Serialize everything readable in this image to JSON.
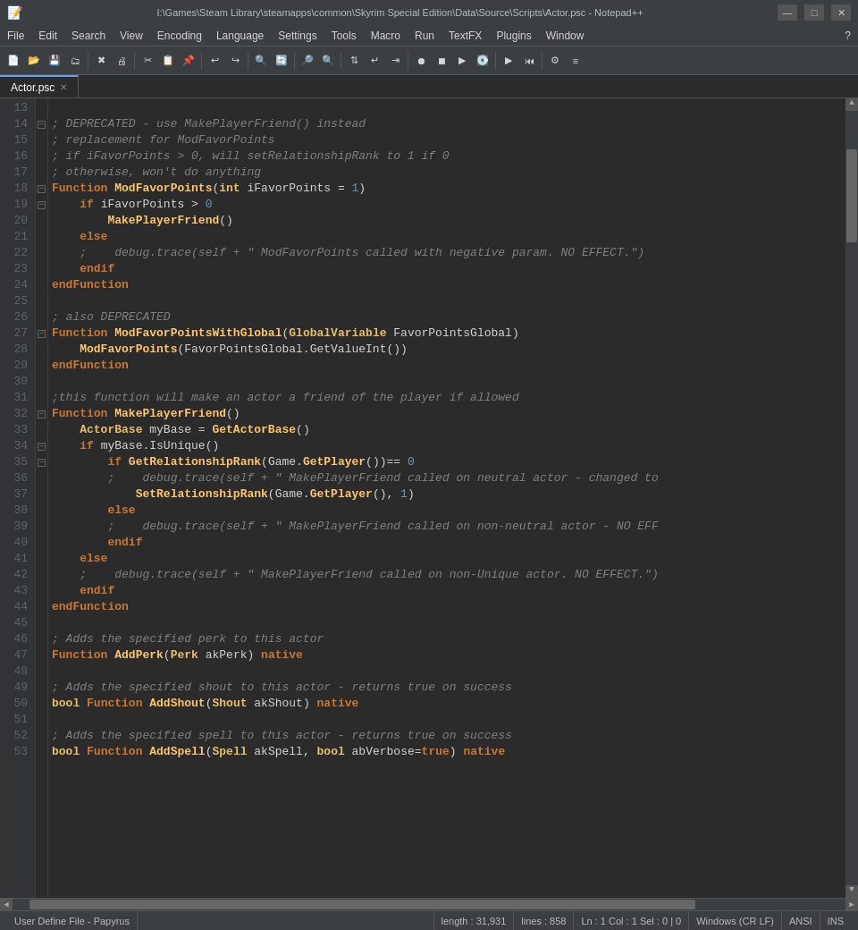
{
  "window": {
    "title": "I:\\Games\\Steam Library\\steamapps\\common\\Skyrim Special Edition\\Data\\Source\\Scripts\\Actor.psc - Notepad++",
    "controls": {
      "minimize": "—",
      "maximize": "□",
      "close": "✕"
    }
  },
  "menu": {
    "items": [
      "File",
      "Edit",
      "Search",
      "View",
      "Encoding",
      "Language",
      "Settings",
      "Tools",
      "Macro",
      "Run",
      "TextFX",
      "Plugins",
      "Window",
      "?"
    ]
  },
  "tab": {
    "label": "Actor.psc"
  },
  "status_bar": {
    "file_type": "User Define File - Papyrus",
    "length": "length : 31,931",
    "lines": "lines : 858",
    "cursor": "Ln : 1   Col : 1   Sel : 0 | 0",
    "line_ending": "Windows (CR LF)",
    "encoding": "ANSI",
    "insert": "INS"
  },
  "lines": [
    {
      "num": "13",
      "fold": "",
      "content": ""
    },
    {
      "num": "14",
      "fold": "⊟",
      "content": "<comment>; DEPRECATED - use MakePlayerFriend() instead</comment>"
    },
    {
      "num": "15",
      "fold": "",
      "content": "<comment>; replacement for ModFavorPoints</comment>"
    },
    {
      "num": "16",
      "fold": "",
      "content": "<comment>; if iFavorPoints &gt; 0, will setRelationshipRank to 1 if 0</comment>"
    },
    {
      "num": "17",
      "fold": "",
      "content": "<comment>; otherwise, won't do anything</comment>"
    },
    {
      "num": "18",
      "fold": "⊟",
      "content": "<kw>Function</kw> <fn>ModFavorPoints</fn>(<type>int</type> iFavorPoints = <num>1</num>)"
    },
    {
      "num": "19",
      "fold": "⊟",
      "content": "    <kw>if</kw> iFavorPoints &gt; <num>0</num>"
    },
    {
      "num": "20",
      "fold": "",
      "content": "        <fn>MakePlayerFriend</fn>()"
    },
    {
      "num": "21",
      "fold": "",
      "content": "    <kw>else</kw>"
    },
    {
      "num": "22",
      "fold": "",
      "content": "    <comment>;    debug.trace(self + \" ModFavorPoints called with negative param. NO EFFECT.\")</comment>"
    },
    {
      "num": "23",
      "fold": "",
      "content": "    <kw>endif</kw>"
    },
    {
      "num": "24",
      "fold": "",
      "content": "<kw>endFunction</kw>"
    },
    {
      "num": "25",
      "fold": "",
      "content": ""
    },
    {
      "num": "26",
      "fold": "",
      "content": "<comment>; also DEPRECATED</comment>"
    },
    {
      "num": "27",
      "fold": "⊟",
      "content": "<kw>Function</kw> <fn>ModFavorPointsWithGlobal</fn>(<type>GlobalVariable</type> FavorPointsGlobal)"
    },
    {
      "num": "28",
      "fold": "",
      "content": "    <fn>ModFavorPoints</fn>(FavorPointsGlobal.GetValueInt())"
    },
    {
      "num": "29",
      "fold": "",
      "content": "<kw>endFunction</kw>"
    },
    {
      "num": "30",
      "fold": "",
      "content": ""
    },
    {
      "num": "31",
      "fold": "",
      "content": "<comment>;this function will make an actor a friend of the player if allowed</comment>"
    },
    {
      "num": "32",
      "fold": "⊟",
      "content": "<kw>Function</kw> <fn>MakePlayerFriend</fn>()"
    },
    {
      "num": "33",
      "fold": "",
      "content": "    <type>ActorBase</type> myBase = <fn>GetActorBase</fn>()"
    },
    {
      "num": "34",
      "fold": "⊟",
      "content": "    <kw>if</kw> myBase.IsUnique()"
    },
    {
      "num": "35",
      "fold": "⊟",
      "content": "        <kw>if</kw> <fn>GetRelationshipRank</fn>(Game.<fn>GetPlayer</fn>())== <num>0</num>"
    },
    {
      "num": "36",
      "fold": "",
      "content": "        <comment>;    debug.trace(self + \" MakePlayerFriend called on neutral actor - changed to</comment>"
    },
    {
      "num": "37",
      "fold": "",
      "content": "            <fn>SetRelationshipRank</fn>(Game.<fn>GetPlayer</fn>(), <num>1</num>)"
    },
    {
      "num": "38",
      "fold": "",
      "content": "        <kw>else</kw>"
    },
    {
      "num": "39",
      "fold": "",
      "content": "        <comment>;    debug.trace(self + \" MakePlayerFriend called on non-neutral actor - NO EFF</comment>"
    },
    {
      "num": "40",
      "fold": "",
      "content": "        <kw>endif</kw>"
    },
    {
      "num": "41",
      "fold": "",
      "content": "    <kw>else</kw>"
    },
    {
      "num": "42",
      "fold": "",
      "content": "    <comment>;    debug.trace(self + \" MakePlayerFriend called on non-Unique actor. NO EFFECT.\")</comment>"
    },
    {
      "num": "43",
      "fold": "",
      "content": "    <kw>endif</kw>"
    },
    {
      "num": "44",
      "fold": "",
      "content": "<kw>endFunction</kw>"
    },
    {
      "num": "45",
      "fold": "",
      "content": ""
    },
    {
      "num": "46",
      "fold": "",
      "content": "<comment>; Adds the specified perk to this actor</comment>"
    },
    {
      "num": "47",
      "fold": "",
      "content": "<kw>Function</kw> <fn>AddPerk</fn>(<type>Perk</type> akPerk) <native>native</native>"
    },
    {
      "num": "48",
      "fold": "",
      "content": ""
    },
    {
      "num": "49",
      "fold": "",
      "content": "<comment>; Adds the specified shout to this actor - returns true on success</comment>"
    },
    {
      "num": "50",
      "fold": "",
      "content": "<type>bool</type> <kw>Function</kw> <fn>AddShout</fn>(<type>Shout</type> akShout) <native>native</native>"
    },
    {
      "num": "51",
      "fold": "",
      "content": ""
    },
    {
      "num": "52",
      "fold": "",
      "content": "<comment>; Adds the specified spell to this actor - returns true on success</comment>"
    },
    {
      "num": "53",
      "fold": "",
      "content": "<type>bool</type> <kw>Function</kw> <fn>AddSpell</fn>(<type>Spell</type> akSpell, <type>bool</type> abVerbose=<kw>true</kw>) <native>native</native>"
    }
  ]
}
